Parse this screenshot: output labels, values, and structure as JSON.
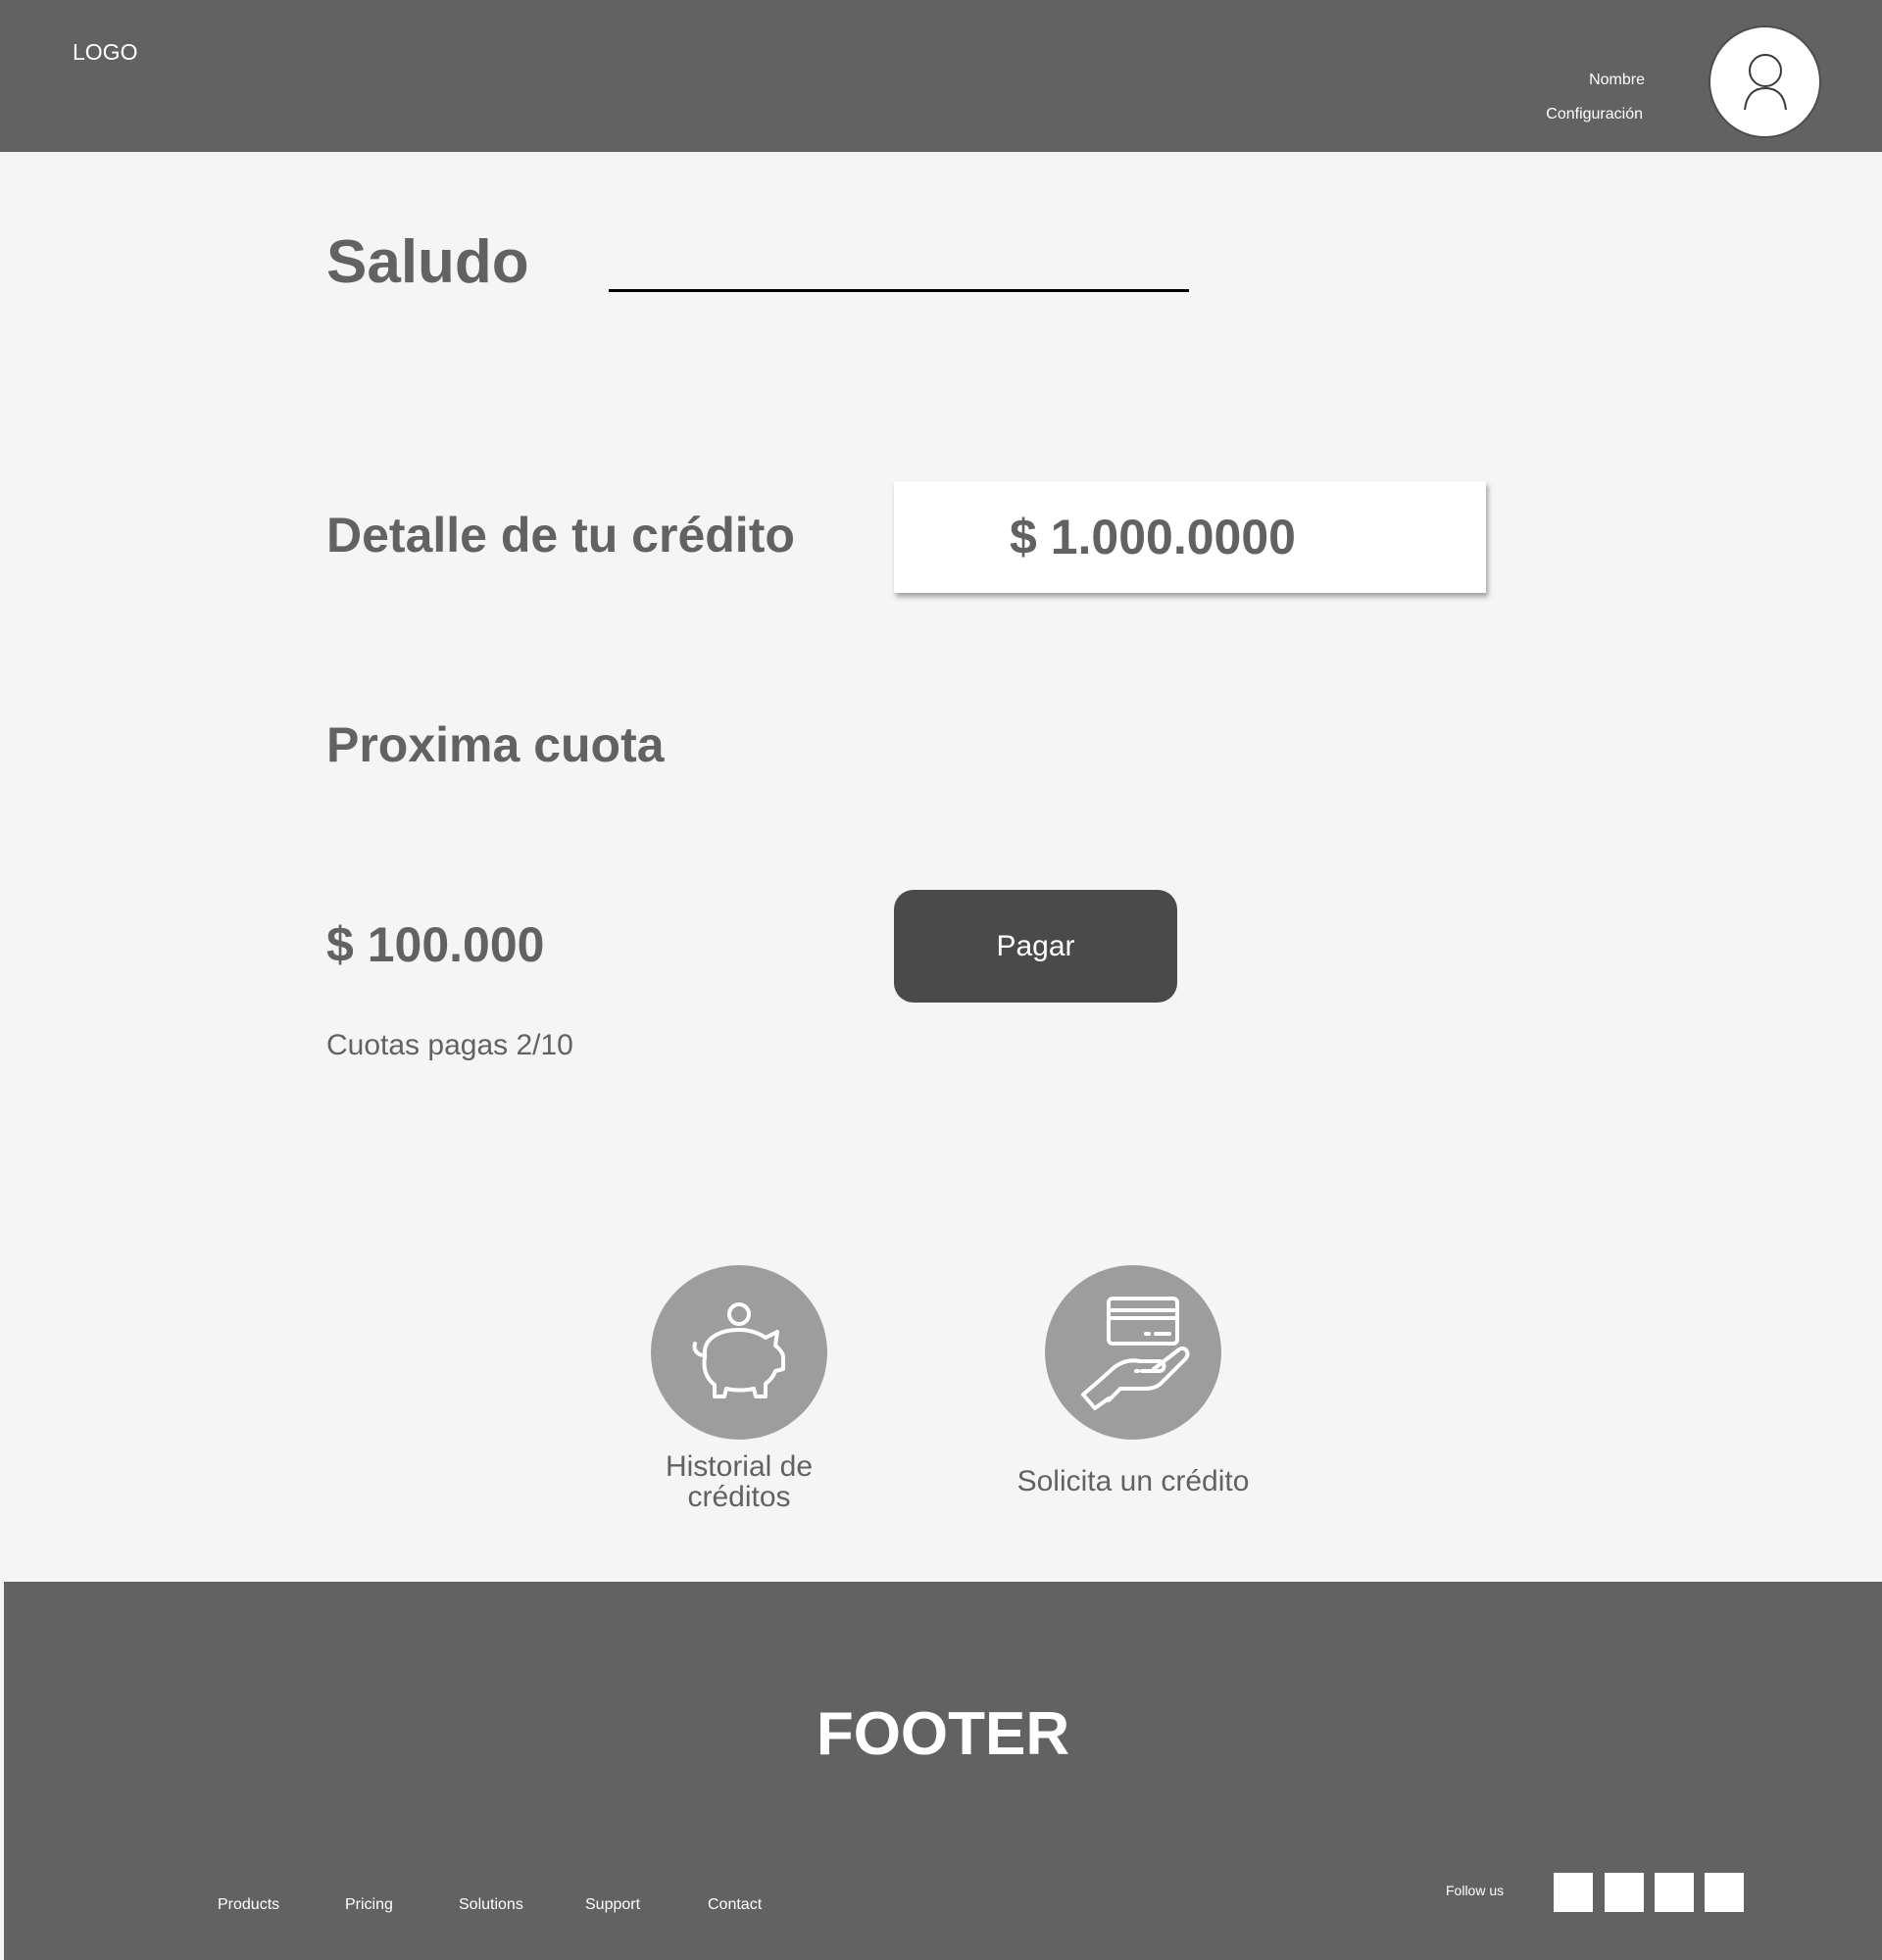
{
  "header": {
    "logo": "LOGO",
    "user_name": "Nombre",
    "user_config": "Configuración"
  },
  "main": {
    "greeting": "Saludo",
    "credit_label": "Detalle de tu crédito",
    "credit_amount": "$ 1.000.0000",
    "next_label": "Proxima cuota",
    "next_amount": "$ 100.000",
    "pay_label": "Pagar",
    "installments": "Cuotas pagas 2/10"
  },
  "actions": {
    "history_label": "Historial de\ncréditos",
    "request_label": "Solicita un crédito",
    "history_icon": "piggy-bank-icon",
    "request_icon": "card-in-hand-icon"
  },
  "footer": {
    "title": "FOOTER",
    "links": [
      "Products",
      "Pricing",
      "Solutions",
      "Support",
      "Contact"
    ],
    "follow_us": "Follow us"
  },
  "colors": {
    "header_bg": "#626262",
    "page_bg": "#f5f5f5",
    "text": "#626262",
    "button_bg": "#4a4a4a",
    "icon_circle": "#9d9d9d"
  }
}
